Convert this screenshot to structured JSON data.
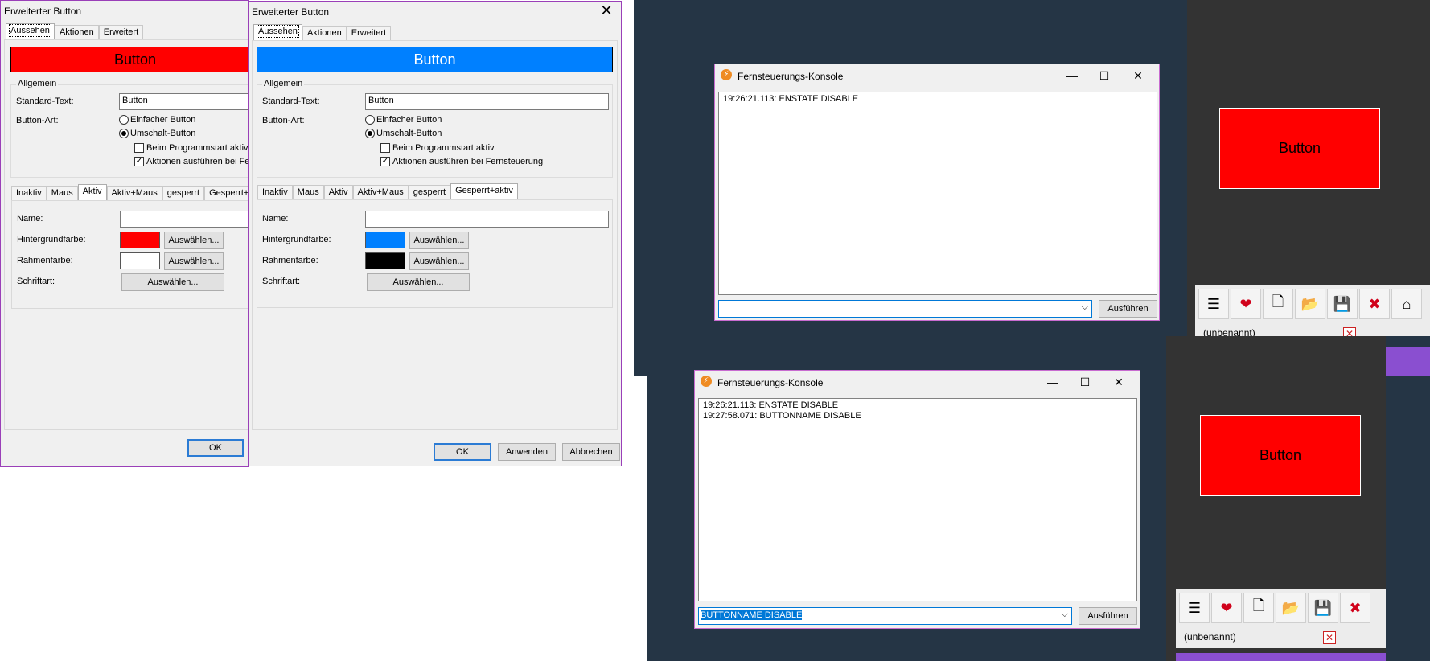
{
  "dialog": {
    "title": "Erweiterter Button",
    "close_glyph": "✕",
    "main_tabs": [
      "Aussehen",
      "Aktionen",
      "Erweitert"
    ],
    "preview_text": "Button",
    "group_title": "Allgemein",
    "standard_text_label": "Standard-Text:",
    "standard_text_value": "Button",
    "button_type_label": "Button-Art:",
    "radio_simple": "Einfacher Button",
    "radio_toggle": "Umschalt-Button",
    "check_start_active": "Beim Programmstart aktiv",
    "check_remote_actions": "Aktionen ausführen bei Fernsteuerung",
    "state_tabs": [
      "Inaktiv",
      "Maus",
      "Aktiv",
      "Aktiv+Maus",
      "gesperrt",
      "Gesperrt+aktiv"
    ],
    "name_label": "Name:",
    "bg_color_label": "Hintergrundfarbe:",
    "border_color_label": "Rahmenfarbe:",
    "font_label": "Schriftart:",
    "choose_label": "Auswählen...",
    "ok_label": "OK",
    "apply_label": "Anwenden",
    "cancel_label": "Abbrechen"
  },
  "dialog_a": {
    "preview_color": "#ff0000",
    "bg_color": "#ff0000",
    "border_color": "#ffffff",
    "selected_state_tab": "Aktiv"
  },
  "dialog_b": {
    "preview_color": "#0080ff",
    "bg_color": "#0080ff",
    "border_color": "#000000",
    "selected_state_tab": "Gesperrt+aktiv"
  },
  "console": {
    "title": "Fernsteuerungs-Konsole",
    "icon_glyph": "⚡",
    "minimize_glyph": "—",
    "maximize_glyph": "☐",
    "close_glyph": "✕",
    "run_label": "Ausführen",
    "dropdown_glyph": "⌵"
  },
  "console_a": {
    "log": [
      "19:26:21.113: ENSTATE DISABLE"
    ],
    "command": ""
  },
  "console_b": {
    "log": [
      "19:26:21.113: ENSTATE DISABLE",
      "19:27:58.071: BUTTONNAME DISABLE"
    ],
    "command": "BUTTONNAME DISABLE"
  },
  "preview_pane": {
    "button_text": "Button",
    "button_color": "#ff0000",
    "status_text": "(unbenannt)",
    "status_close_glyph": "✕",
    "toolbar_icons": [
      {
        "name": "menu-icon",
        "glyph": "☰"
      },
      {
        "name": "heart-icon",
        "glyph": "❤"
      },
      {
        "name": "new-file-icon",
        "glyph": "🗋"
      },
      {
        "name": "open-folder-icon",
        "glyph": "📂"
      },
      {
        "name": "save-icon",
        "glyph": "💾"
      },
      {
        "name": "delete-icon",
        "glyph": "✖"
      },
      {
        "name": "home-icon",
        "glyph": "⌂"
      }
    ]
  }
}
